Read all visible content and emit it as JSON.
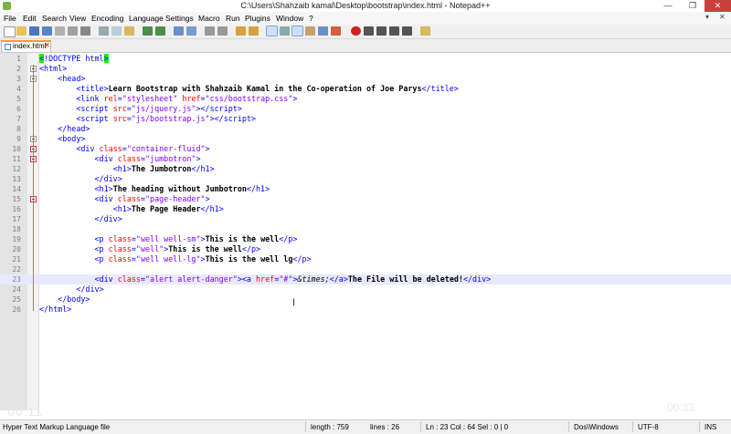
{
  "window": {
    "title": "C:\\Users\\Shahzaib kamal\\Desktop\\bootstrap\\index.html - Notepad++",
    "minimize": "—",
    "maximize": "❐",
    "close": "✕"
  },
  "menu": {
    "items": [
      "File",
      "Edit",
      "Search",
      "View",
      "Encoding",
      "Language",
      "Settings",
      "Macro",
      "Run",
      "Plugins",
      "Window",
      "?"
    ],
    "doc_controls": [
      "▾",
      "✕"
    ]
  },
  "tab": {
    "label": "index.html",
    "close": "✕"
  },
  "editor": {
    "lines": [
      "1",
      "2",
      "3",
      "4",
      "5",
      "6",
      "7",
      "8",
      "9",
      "10",
      "11",
      "12",
      "13",
      "14",
      "15",
      "16",
      "17",
      "18",
      "19",
      "20",
      "21",
      "22",
      "23",
      "24",
      "25",
      "26"
    ],
    "current_line": 23
  },
  "status": {
    "language": "Hyper Text Markup Language file",
    "length": "length : 759",
    "lines": "lines : 26",
    "position": "Ln : 23   Col : 64   Sel : 0 | 0",
    "eol": "Dos\\Windows",
    "encoding": "UTF-8",
    "mode": "INS"
  },
  "overlay": {
    "left_text": "00:11",
    "right_text": "00:33"
  },
  "colors": {
    "tag": "#0000ff",
    "attribute": "#ff0000",
    "value": "#8000ff",
    "current_line": "#e8e8ff",
    "close_button": "#c7413a"
  }
}
